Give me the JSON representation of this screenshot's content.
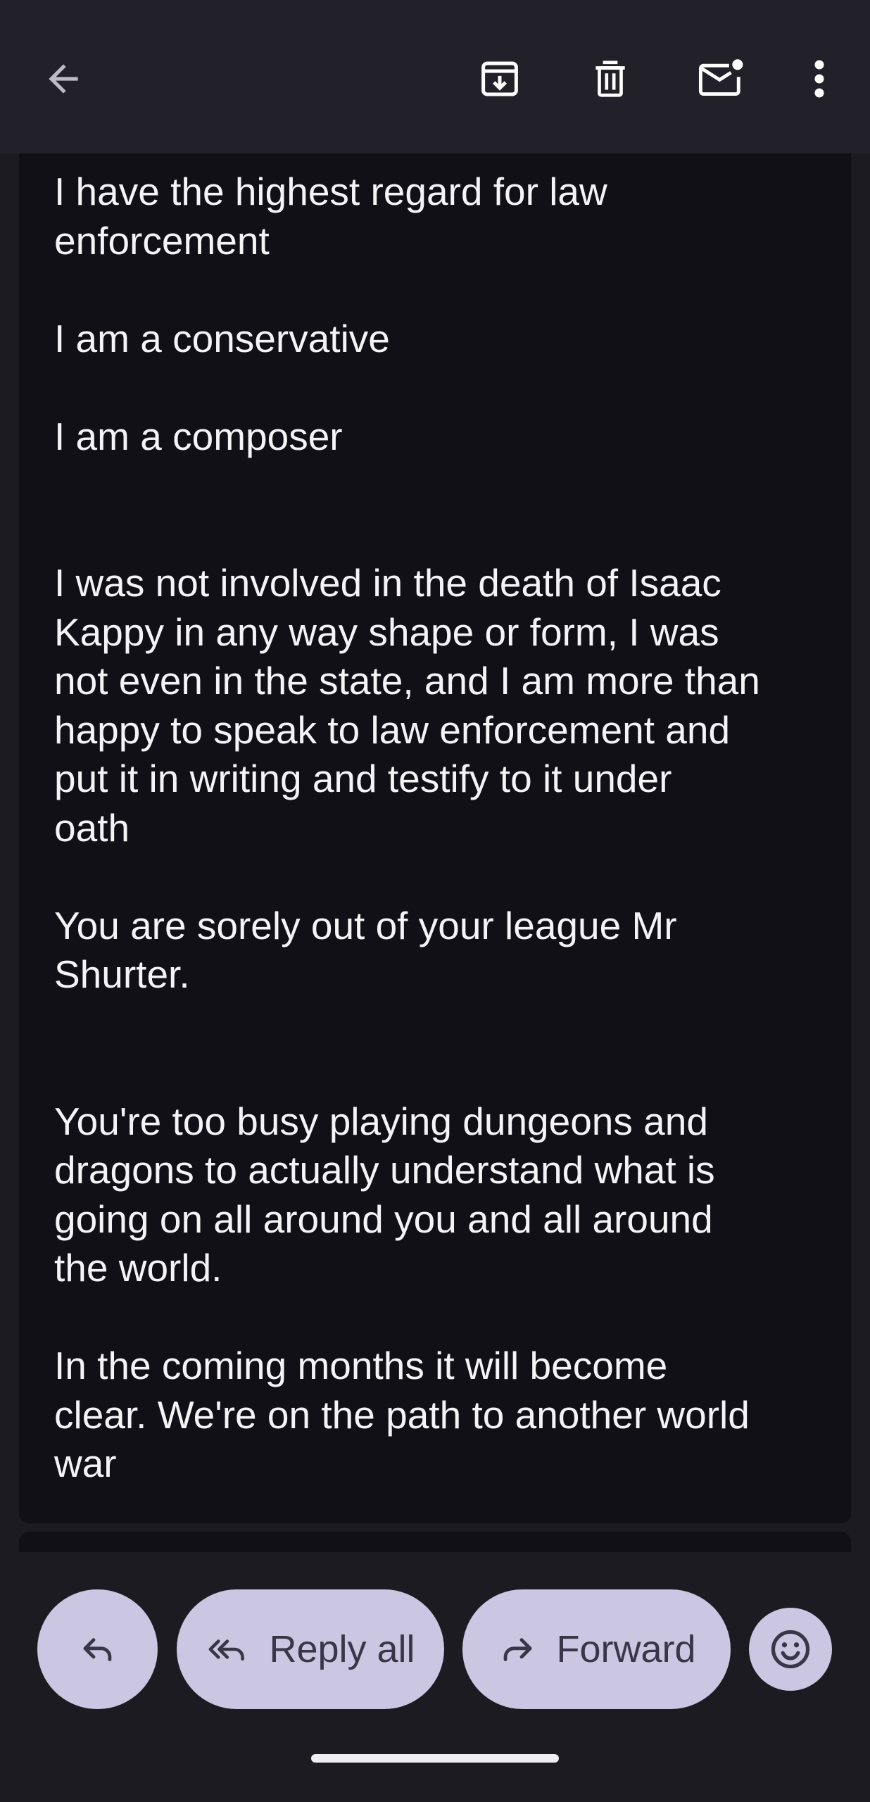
{
  "toolbar": {
    "back_icon": "arrow-back-icon",
    "archive_icon": "archive-icon",
    "delete_icon": "delete-icon",
    "mark_unread_icon": "mark-unread-icon",
    "more_icon": "more-vert-icon"
  },
  "email": {
    "paragraphs": [
      "I have the highest regard for law\nenforcement",
      "I am a conservative",
      "I am a composer",
      "I was not involved in the death of Isaac\nKappy in any way shape or form, I was\nnot even in the state, and I am more than\nhappy to speak to law enforcement and\nput it in writing and testify to it under\noath",
      "You are sorely out of your league Mr\nShurter.",
      "You're too busy playing dungeons and\ndragons to actually understand what is\ngoing on all around you and all around\nthe world.",
      "In the coming months it will become\nclear. We're on the path to another world\nwar"
    ]
  },
  "actions": {
    "reply_icon": "reply-icon",
    "reply_all_label": "Reply all",
    "forward_label": "Forward",
    "emoji_icon": "smiley-icon"
  },
  "colors": {
    "background": "#1c1b21",
    "card": "#111016",
    "pill": "#cbc6e1",
    "pill_text": "#3a3648"
  }
}
